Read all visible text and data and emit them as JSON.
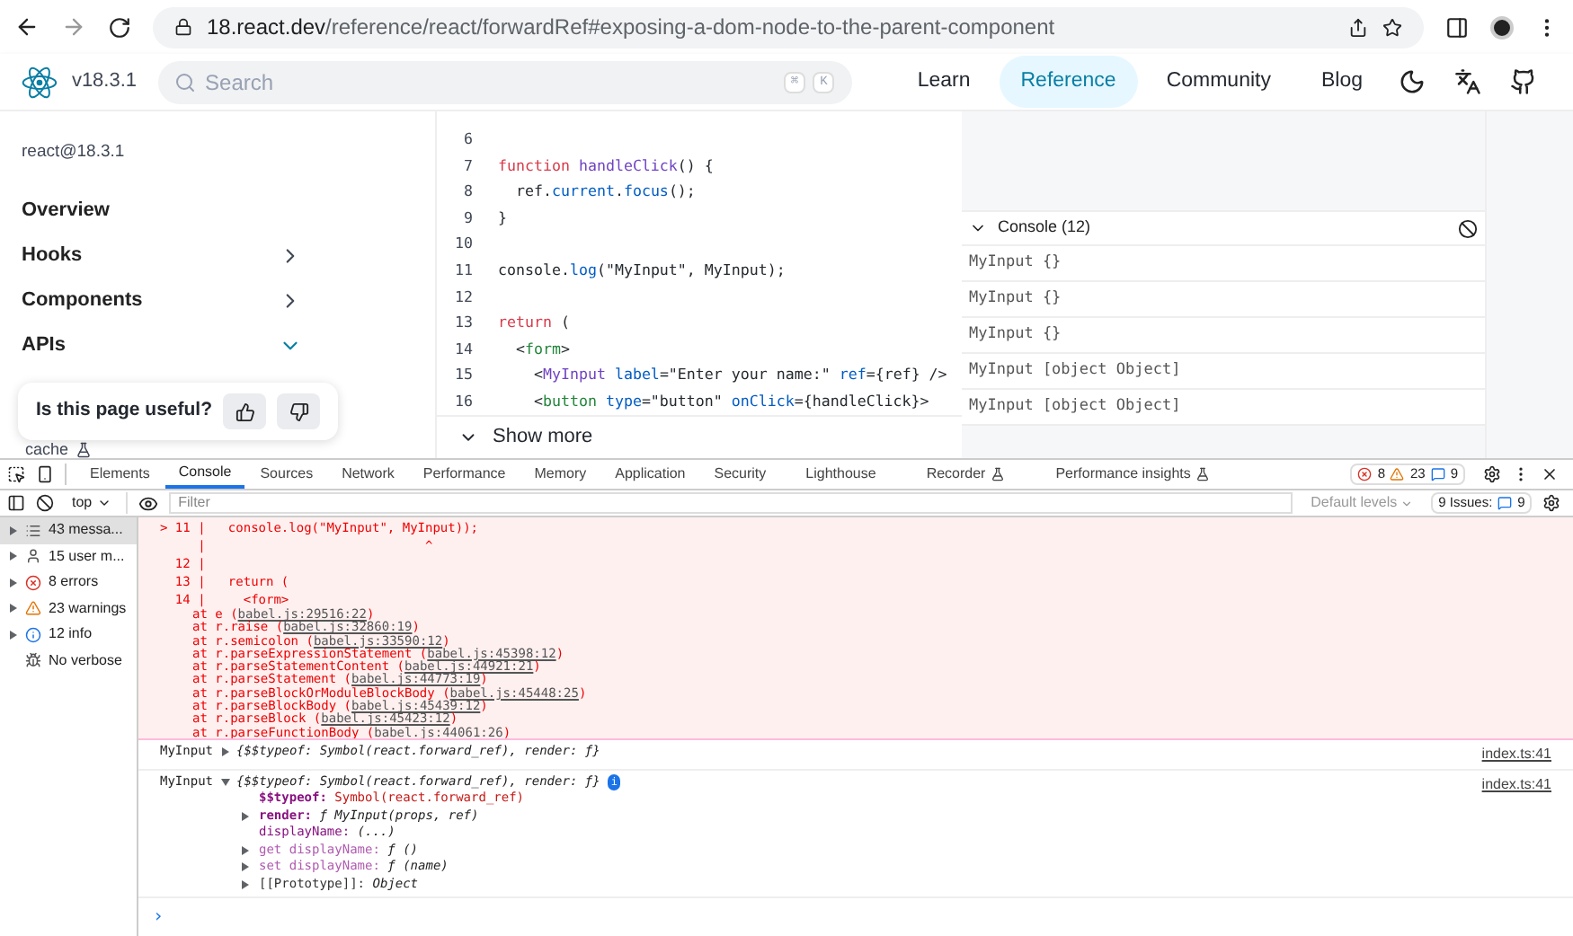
{
  "browser": {
    "url_host": "18.react.dev",
    "url_path": "/reference/react/forwardRef#exposing-a-dom-node-to-the-parent-component"
  },
  "site": {
    "version": "v18.3.1",
    "search_placeholder": "Search",
    "keys": [
      "⌘",
      "K"
    ],
    "nav": [
      {
        "label": "Learn",
        "selected": false
      },
      {
        "label": "Reference",
        "selected": true
      },
      {
        "label": "Community",
        "selected": false
      },
      {
        "label": "Blog",
        "selected": false
      }
    ]
  },
  "sidebar": {
    "package": "react@18.3.1",
    "items": [
      {
        "label": "Overview",
        "kind": "plain"
      },
      {
        "label": "Hooks",
        "kind": "collapsed"
      },
      {
        "label": "Components",
        "kind": "collapsed"
      },
      {
        "label": "APIs",
        "kind": "expanded"
      }
    ],
    "feedback": "Is this page useful?",
    "cut_item": "cache"
  },
  "code": {
    "lines": [
      {
        "n": "6"
      },
      {
        "n": "7",
        "tokens": [
          {
            "text": "function ",
            "kind": "kw"
          },
          {
            "text": "handleClick",
            "kind": "fn"
          },
          {
            "text": "() {",
            "kind": "p"
          }
        ]
      },
      {
        "n": "8",
        "tokens": [
          {
            "text": "  ref.",
            "kind": "p"
          },
          {
            "text": "current",
            "kind": "prop"
          },
          {
            "text": ".",
            "kind": "p"
          },
          {
            "text": "focus",
            "kind": "prop"
          },
          {
            "text": "();",
            "kind": "p"
          }
        ]
      },
      {
        "n": "9",
        "tokens": [
          {
            "text": "}",
            "kind": "p"
          }
        ]
      },
      {
        "n": "10"
      },
      {
        "n": "11",
        "tokens": [
          {
            "text": "console.",
            "kind": "p"
          },
          {
            "text": "log",
            "kind": "prop"
          },
          {
            "text": "(\"MyInput\", MyInput);",
            "kind": "p"
          }
        ]
      },
      {
        "n": "12"
      },
      {
        "n": "13",
        "tokens": [
          {
            "text": "return ",
            "kind": "kw"
          },
          {
            "text": "(",
            "kind": "p"
          }
        ]
      },
      {
        "n": "14",
        "tokens": [
          {
            "text": "  <",
            "kind": "p"
          },
          {
            "text": "form",
            "kind": "tag"
          },
          {
            "text": ">",
            "kind": "p"
          }
        ]
      },
      {
        "n": "15",
        "tokens": [
          {
            "text": "    <",
            "kind": "p"
          },
          {
            "text": "MyInput ",
            "kind": "fn"
          },
          {
            "text": "label",
            "kind": "prop"
          },
          {
            "text": "=\"Enter your name:\" ",
            "kind": "p"
          },
          {
            "text": "ref",
            "kind": "prop"
          },
          {
            "text": "={ref} />",
            "kind": "p"
          }
        ]
      },
      {
        "n": "16",
        "tokens": [
          {
            "text": "    <",
            "kind": "p"
          },
          {
            "text": "button ",
            "kind": "tag"
          },
          {
            "text": "type",
            "kind": "prop"
          },
          {
            "text": "=\"button\" ",
            "kind": "p"
          },
          {
            "text": "onClick",
            "kind": "prop"
          },
          {
            "text": "={handleClick}>",
            "kind": "p"
          }
        ]
      }
    ],
    "show_more": "Show more"
  },
  "sandbox_console": {
    "title": "Console (12)",
    "rows": [
      "MyInput {}",
      "MyInput {}",
      "MyInput {}",
      "MyInput [object Object]",
      "MyInput [object Object]"
    ]
  },
  "devtools": {
    "tabs": [
      {
        "label": "Elements",
        "selected": false,
        "flask": false
      },
      {
        "label": "Console",
        "selected": true,
        "flask": false
      },
      {
        "label": "Sources",
        "selected": false,
        "flask": false
      },
      {
        "label": "Network",
        "selected": false,
        "flask": false
      },
      {
        "label": "Performance",
        "selected": false,
        "flask": false
      },
      {
        "label": "Memory",
        "selected": false,
        "flask": false
      },
      {
        "label": "Application",
        "selected": false,
        "flask": false
      },
      {
        "label": "Security",
        "selected": false,
        "flask": false
      },
      {
        "label": "Lighthouse",
        "selected": false,
        "flask": false
      },
      {
        "label": "Recorder",
        "selected": false,
        "flask": true
      },
      {
        "label": "Performance insights",
        "selected": false,
        "flask": true
      }
    ],
    "counts": {
      "errors": "8",
      "warnings": "23",
      "info": "9"
    },
    "context": "top",
    "filter_placeholder": "Filter",
    "levels": "Default levels",
    "issues_label": "9 Issues:",
    "issues_count": "9",
    "sidebar": [
      {
        "label": "43 messa...",
        "kind": "list",
        "selected": true
      },
      {
        "label": "15 user m...",
        "kind": "user",
        "selected": false
      },
      {
        "label": "8 errors",
        "kind": "error",
        "selected": false
      },
      {
        "label": "23 warnings",
        "kind": "warning",
        "selected": false
      },
      {
        "label": "12 info",
        "kind": "info",
        "selected": false
      },
      {
        "label": "No verbose",
        "kind": "verbose",
        "selected": false
      }
    ],
    "error": {
      "code": [
        "> 11 |   console.log(\"MyInput\", MyInput));",
        "     |                             ^",
        "  12 |",
        "  13 |   return (",
        "  14 |     <form>"
      ],
      "stack": [
        {
          "fn": "at e (",
          "src": "babel.js:29516:22",
          "tail": ")"
        },
        {
          "fn": "at r.raise (",
          "src": "babel.js:32860:19",
          "tail": ")"
        },
        {
          "fn": "at r.semicolon (",
          "src": "babel.js:33590:12",
          "tail": ")"
        },
        {
          "fn": "at r.parseExpressionStatement (",
          "src": "babel.js:45398:12",
          "tail": ")"
        },
        {
          "fn": "at r.parseStatementContent (",
          "src": "babel.js:44921:21",
          "tail": ")"
        },
        {
          "fn": "at r.parseStatement (",
          "src": "babel.js:44773:19",
          "tail": ")"
        },
        {
          "fn": "at r.parseBlockOrModuleBlockBody (",
          "src": "babel.js:45448:25",
          "tail": ")"
        },
        {
          "fn": "at r.parseBlockBody (",
          "src": "babel.js:45439:12",
          "tail": ")"
        },
        {
          "fn": "at r.parseBlock (",
          "src": "babel.js:45423:12",
          "tail": ")"
        },
        {
          "fn": "at r.parseFunctionBody (",
          "src": "babel.js:44061:26",
          "tail": ")"
        }
      ]
    },
    "logs": [
      {
        "label": "MyInput",
        "summary": "{$$typeof: Symbol(react.forward_ref), render: ƒ}",
        "expanded": false,
        "source": "index.ts:41"
      },
      {
        "label": "MyInput",
        "summary": "{$$typeof: Symbol(react.forward_ref), render: ƒ}",
        "expanded": true,
        "source": "index.ts:41",
        "badge": "i",
        "props": [
          {
            "key": "$$typeof:",
            "value": "Symbol(react.forward_ref)",
            "arrow": false,
            "kind": "own"
          },
          {
            "key": "render:",
            "value": "ƒ MyInput(props, ref)",
            "arrow": true,
            "kind": "own"
          },
          {
            "key": "displayName:",
            "value": "(...)",
            "arrow": false,
            "kind": "getter"
          },
          {
            "key": "get displayName:",
            "value": "ƒ ()",
            "arrow": true,
            "kind": "accessor"
          },
          {
            "key": "set displayName:",
            "value": "ƒ (name)",
            "arrow": true,
            "kind": "accessor"
          },
          {
            "key": "[[Prototype]]:",
            "value": "Object",
            "arrow": true,
            "kind": "proto"
          }
        ]
      }
    ],
    "prompt": "›"
  }
}
